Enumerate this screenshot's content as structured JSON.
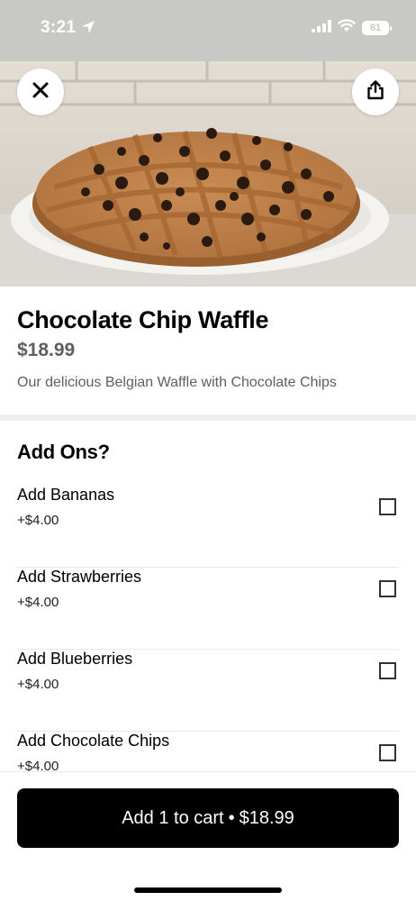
{
  "status_bar": {
    "time": "3:21",
    "battery": "81",
    "icons": [
      "location-arrow-icon",
      "signal-icon",
      "wifi-icon",
      "battery-icon"
    ]
  },
  "hero": {
    "close_icon": "close-icon",
    "share_icon": "share-icon"
  },
  "item": {
    "title": "Chocolate Chip Waffle",
    "price": "$18.99",
    "description": "Our delicious Belgian Waffle with Chocolate Chips"
  },
  "addons": {
    "title": "Add Ons?",
    "items": [
      {
        "name": "Add Bananas",
        "price": "+$4.00",
        "checked": false
      },
      {
        "name": "Add Strawberries",
        "price": "+$4.00",
        "checked": false
      },
      {
        "name": "Add Blueberries",
        "price": "+$4.00",
        "checked": false
      },
      {
        "name": "Add Chocolate Chips",
        "price": "+$4.00",
        "checked": false
      }
    ]
  },
  "cart": {
    "label": "Add 1 to cart",
    "separator": "•",
    "total": "$18.99"
  },
  "colors": {
    "status_bar_bg": "#c8c8c4",
    "price_gray": "#5e5e5e",
    "button_bg": "#000000"
  }
}
